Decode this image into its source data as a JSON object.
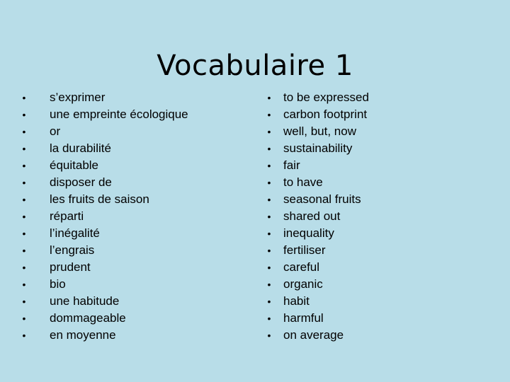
{
  "slide": {
    "title": "Vocabulaire 1",
    "background_color": "#b8dde8",
    "bullet_glyph": "•",
    "french": [
      "s’exprimer",
      "une empreinte écologique",
      "or",
      "la durabilité",
      "équitable",
      "disposer de",
      "les fruits de saison",
      "réparti",
      "l’inégalité",
      "l’engrais",
      "prudent",
      "bio",
      "une habitude",
      "dommageable",
      "en moyenne"
    ],
    "english": [
      "to be expressed",
      "carbon footprint",
      "well, but, now",
      "sustainability",
      "fair",
      "to have",
      "seasonal fruits",
      "shared out",
      "inequality",
      "fertiliser",
      "careful",
      "organic",
      "habit",
      "harmful",
      "on average"
    ]
  }
}
